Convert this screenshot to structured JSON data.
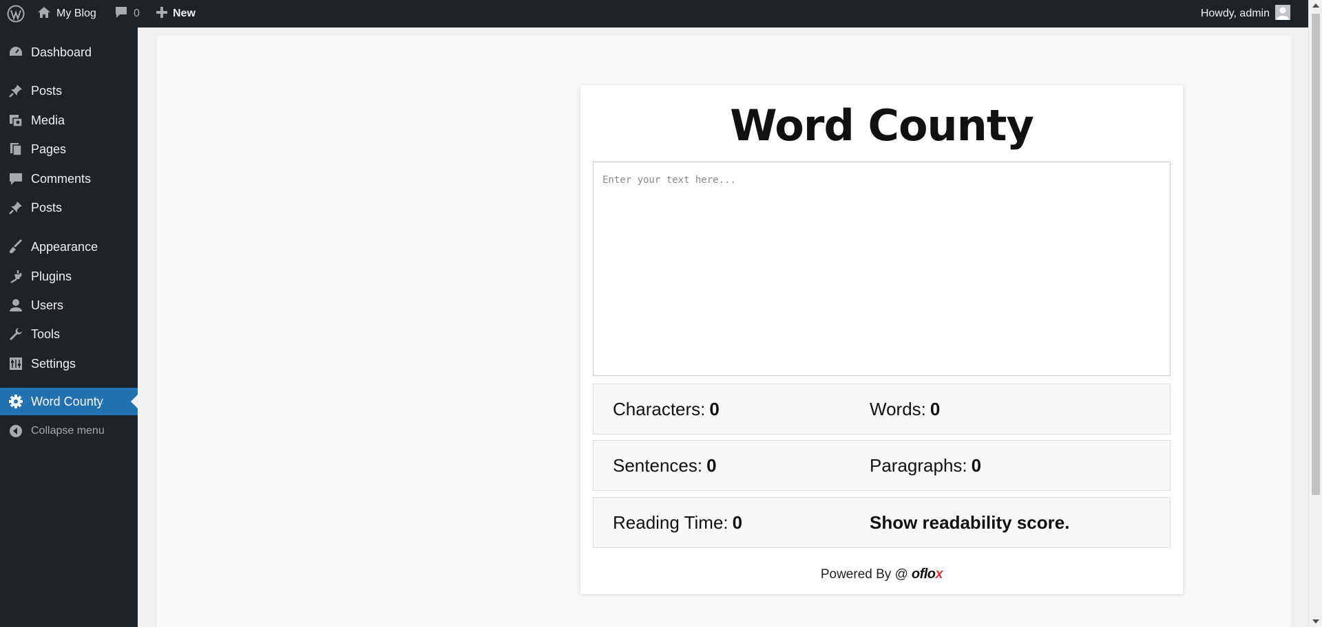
{
  "adminbar": {
    "site_name": "My Blog",
    "comments_count": "0",
    "new_label": "New",
    "greeting": "Howdy, admin"
  },
  "sidebar": {
    "items": [
      {
        "label": "Dashboard",
        "icon": "dashboard-icon"
      },
      {
        "label": "Posts",
        "icon": "pin-icon"
      },
      {
        "label": "Media",
        "icon": "media-icon"
      },
      {
        "label": "Pages",
        "icon": "pages-icon"
      },
      {
        "label": "Comments",
        "icon": "comment-icon"
      },
      {
        "label": "Posts",
        "icon": "pin-icon"
      },
      {
        "label": "Appearance",
        "icon": "brush-icon"
      },
      {
        "label": "Plugins",
        "icon": "plug-icon"
      },
      {
        "label": "Users",
        "icon": "user-icon"
      },
      {
        "label": "Tools",
        "icon": "wrench-icon"
      },
      {
        "label": "Settings",
        "icon": "settings-icon"
      },
      {
        "label": "Word County",
        "icon": "gear-icon",
        "active": true
      },
      {
        "label": "Collapse menu",
        "icon": "collapse-icon"
      }
    ]
  },
  "main": {
    "title": "Word County",
    "textarea_placeholder": "Enter your text here...",
    "stats": {
      "characters_label": "Characters:",
      "characters_value": "0",
      "words_label": "Words:",
      "words_value": "0",
      "sentences_label": "Sentences:",
      "sentences_value": "0",
      "paragraphs_label": "Paragraphs:",
      "paragraphs_value": "0",
      "reading_time_label": "Reading Time:",
      "reading_time_value": "0",
      "readability_link": "Show readability score."
    },
    "powered_by": "Powered By @",
    "brand_main": "oflo",
    "brand_x": "x"
  },
  "colors": {
    "admin_bg": "#1d2327",
    "active_menu": "#2271b1",
    "brand_accent": "#e23744"
  }
}
